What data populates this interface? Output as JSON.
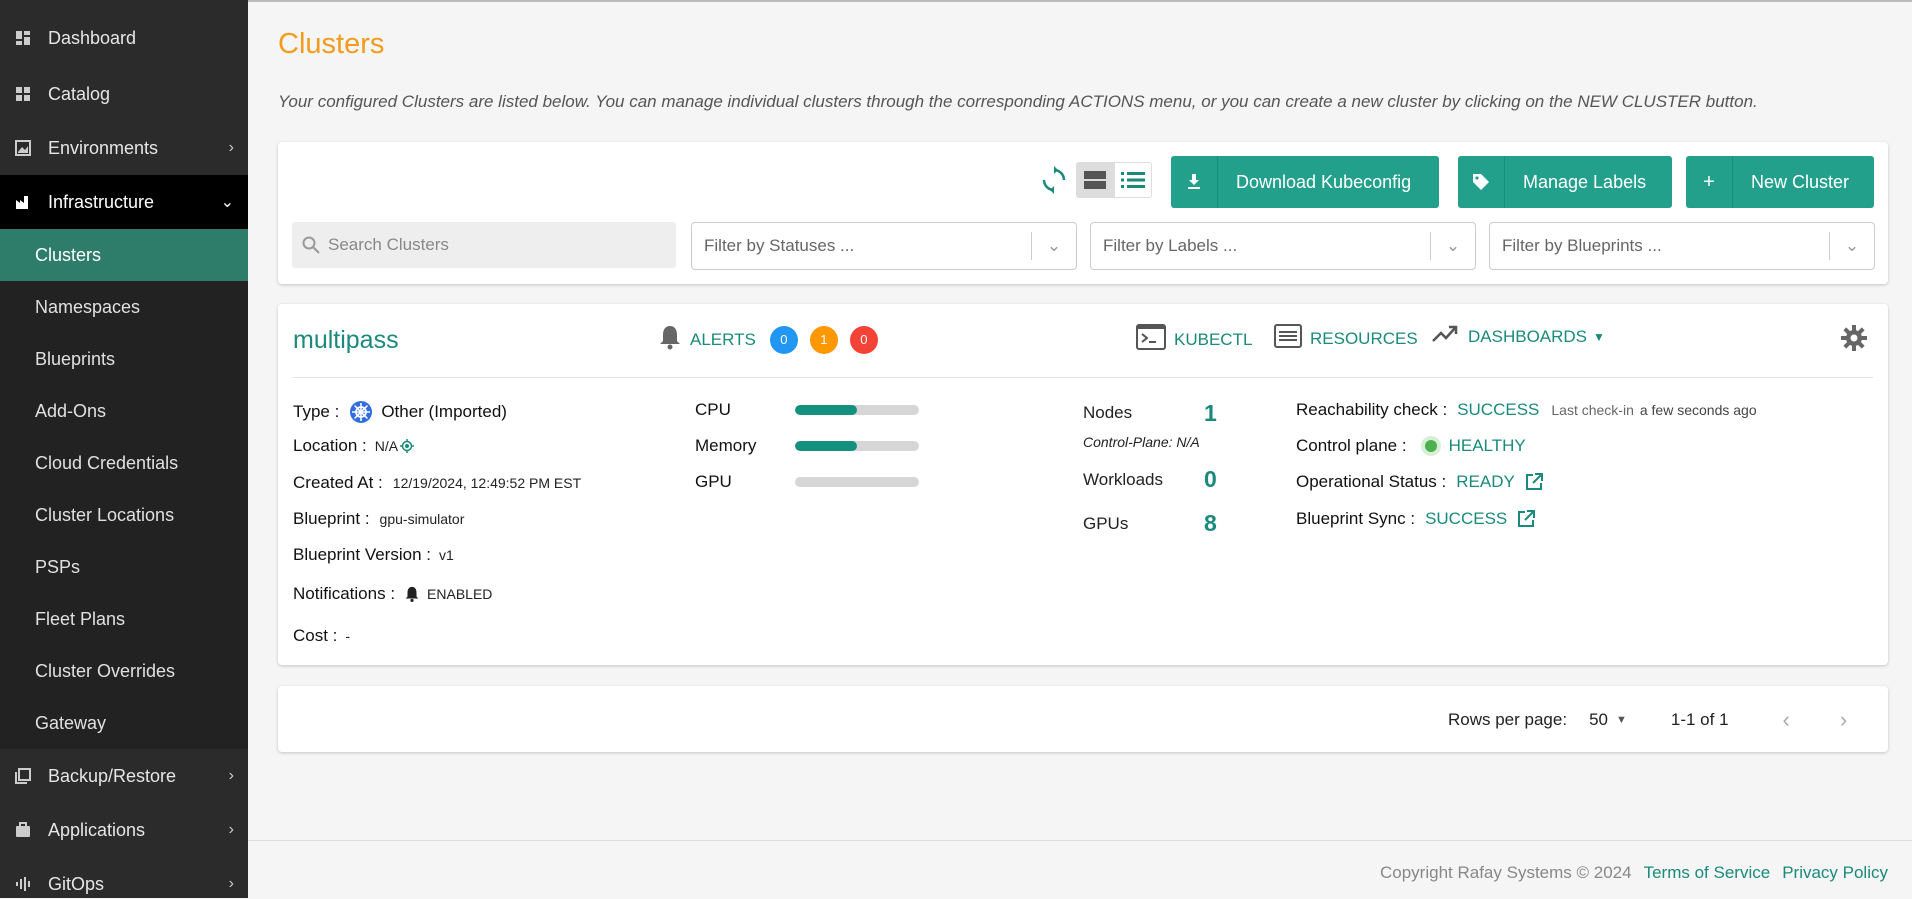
{
  "sidebar": {
    "items": [
      {
        "label": "Dashboard"
      },
      {
        "label": "Catalog"
      },
      {
        "label": "Environments"
      },
      {
        "label": "Infrastructure"
      }
    ],
    "sub_items": [
      {
        "label": "Clusters"
      },
      {
        "label": "Namespaces"
      },
      {
        "label": "Blueprints"
      },
      {
        "label": "Add-Ons"
      },
      {
        "label": "Cloud Credentials"
      },
      {
        "label": "Cluster Locations"
      },
      {
        "label": "PSPs"
      },
      {
        "label": "Fleet Plans"
      },
      {
        "label": "Cluster Overrides"
      },
      {
        "label": "Gateway"
      }
    ],
    "bottom_items": [
      {
        "label": "Backup/Restore"
      },
      {
        "label": "Applications"
      },
      {
        "label": "GitOps"
      }
    ]
  },
  "page": {
    "title": "Clusters",
    "intro": "Your configured Clusters are listed below. You can manage individual clusters through the corresponding ACTIONS menu, or you can create a new cluster by clicking on the NEW CLUSTER button."
  },
  "toolbar": {
    "download_label": "Download Kubeconfig",
    "labels_label": "Manage Labels",
    "new_cluster_label": "New Cluster",
    "search_placeholder": "Search Clusters",
    "filter_statuses": "Filter by Statuses ...",
    "filter_labels": "Filter by Labels ...",
    "filter_blueprints": "Filter by Blueprints ..."
  },
  "cluster": {
    "name": "multipass",
    "alerts_label": "ALERTS",
    "alerts_counts": [
      "0",
      "1",
      "0"
    ],
    "kubectl": "KUBECTL",
    "resources": "RESOURCES",
    "dashboards": "DASHBOARDS",
    "type_label": "Type :",
    "type_value": "Other (Imported)",
    "location_label": "Location :",
    "location_value": "N/A",
    "created_label": "Created At :",
    "created_value": "12/19/2024, 12:49:52 PM EST",
    "blueprint_label": "Blueprint :",
    "blueprint_value": "gpu-simulator",
    "bp_version_label": "Blueprint Version :",
    "bp_version_value": "v1",
    "notif_label": "Notifications :",
    "notif_value": "ENABLED",
    "cost_label": "Cost :",
    "cost_value": "-",
    "cpu_label": "CPU",
    "memory_label": "Memory",
    "gpu_label": "GPU",
    "cpu_usage": 0.5,
    "memory_usage": 0.5,
    "gpu_usage": 0,
    "nodes_label": "Nodes",
    "nodes_value": "1",
    "control_plane_note": "Control-Plane: N/A",
    "workloads_label": "Workloads",
    "workloads_value": "0",
    "gpus_label": "GPUs",
    "gpus_value": "8",
    "reach_label": "Reachability check :",
    "reach_value": "SUCCESS",
    "lastcheck_label": "Last check-in",
    "lastcheck_value": "a few seconds ago",
    "cp_label": "Control plane :",
    "cp_value": "HEALTHY",
    "op_label": "Operational Status :",
    "op_value": "READY",
    "bps_label": "Blueprint Sync :",
    "bps_value": "SUCCESS"
  },
  "pagination": {
    "rows_label": "Rows per page:",
    "rows_value": "50",
    "range": "1-1 of 1"
  },
  "footer": {
    "copyright": "Copyright Rafay Systems © 2024",
    "terms": "Terms of Service",
    "privacy": "Privacy Policy"
  },
  "colors": {
    "accent": "#23a08c",
    "title": "#f29b1d",
    "alert_blue": "#2196f3",
    "alert_orange": "#ff9800",
    "alert_red": "#f44336"
  }
}
